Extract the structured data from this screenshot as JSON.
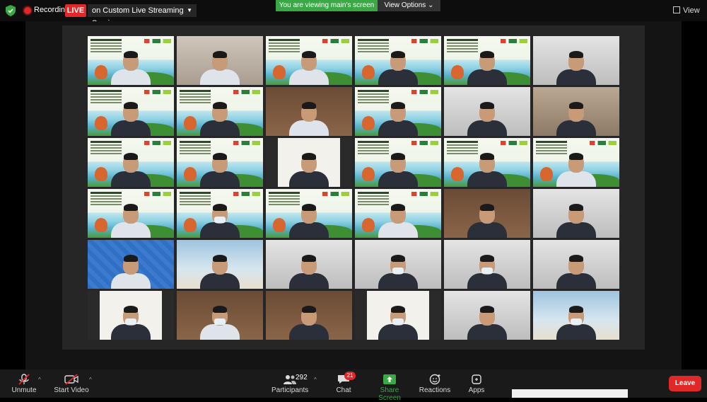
{
  "topbar": {
    "recording_label": "Recording",
    "live_label": "LIVE",
    "stream_service": "on Custom Live Streaming Service",
    "viewing_notice": "You are viewing main's screen",
    "view_options_label": "View Options",
    "view_label": "View"
  },
  "gallery": {
    "rows": 6,
    "columns": 6,
    "tile_count": 36
  },
  "toolbar": {
    "unmute_label": "Unmute",
    "start_video_label": "Start Video",
    "participants_label": "Participants",
    "participants_count": "292",
    "chat_label": "Chat",
    "chat_badge": "21",
    "share_screen_label": "Share Screen",
    "reactions_label": "Reactions",
    "apps_label": "Apps",
    "leave_label": "Leave"
  },
  "colors": {
    "accent_green": "#3aa945",
    "live_red": "#e02828",
    "bar_background": "#1a1a1a"
  }
}
